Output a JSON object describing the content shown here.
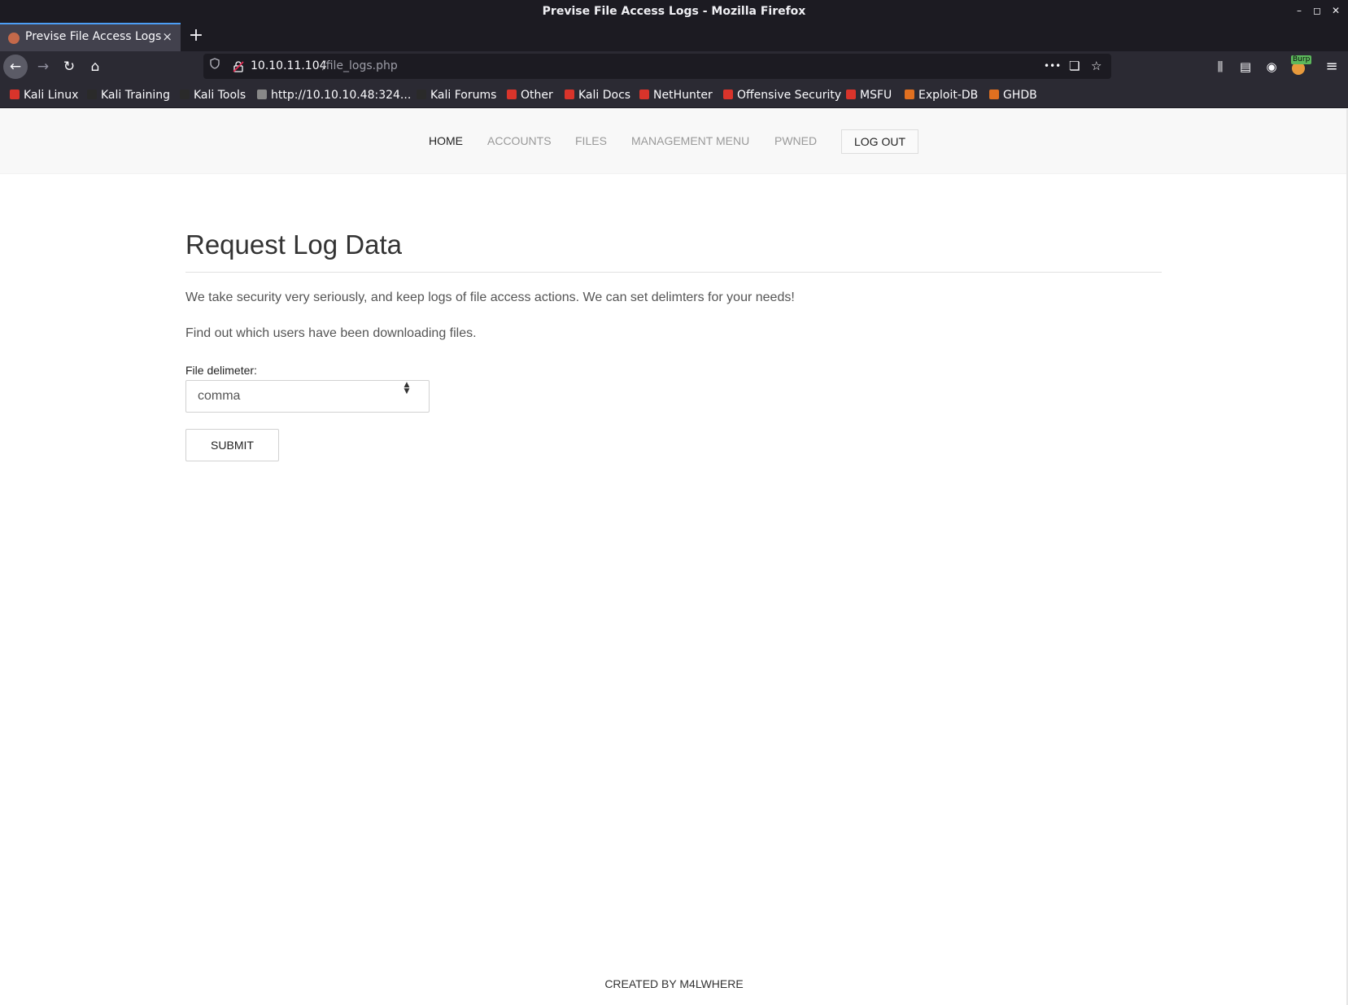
{
  "window": {
    "title": "Previse File Access Logs - Mozilla Firefox",
    "controls": {
      "minimize": "–",
      "maximize": "◻",
      "close": "✕"
    }
  },
  "tabs": [
    {
      "title": "Previse File Access Logs",
      "close": "×",
      "active": true
    }
  ],
  "new_tab_label": "+",
  "navbar": {
    "back_icon": "←",
    "forward_icon": "→",
    "reload_icon": "↻",
    "home_icon": "⌂",
    "url_host": "10.10.11.104",
    "url_path": "/file_logs.php",
    "page_actions_icon": "•••",
    "pocket_icon": "❏",
    "bookmark_star_icon": "☆",
    "library_icon": "⫼",
    "sidebar_icon": "▤",
    "account_icon": "◉",
    "burp_badge": "Burp",
    "menu_icon": "≡"
  },
  "bookmarks": [
    {
      "label": "Kali Linux",
      "color": "#d9342b"
    },
    {
      "label": "Kali Training",
      "color": "#2a2a2a"
    },
    {
      "label": "Kali Tools",
      "color": "#2a2a2a"
    },
    {
      "label": "http://10.10.10.48:324...",
      "color": "#888888"
    },
    {
      "label": "Kali Forums",
      "color": "#2a2a2a"
    },
    {
      "label": "Other",
      "color": "#d9342b"
    },
    {
      "label": "Kali Docs",
      "color": "#d9342b"
    },
    {
      "label": "NetHunter",
      "color": "#d9342b"
    },
    {
      "label": "Offensive Security",
      "color": "#d9342b"
    },
    {
      "label": "MSFU",
      "color": "#d9342b"
    },
    {
      "label": "Exploit-DB",
      "color": "#e07020"
    },
    {
      "label": "GHDB",
      "color": "#e07020"
    }
  ],
  "site_nav": {
    "home": "HOME",
    "accounts": "ACCOUNTS",
    "files": "FILES",
    "management": "MANAGEMENT MENU",
    "pwned": "PWNED",
    "logout": "LOG OUT"
  },
  "main": {
    "heading": "Request Log Data",
    "paragraph1": "We take security very seriously, and keep logs of file access actions. We can set delimters for your needs!",
    "paragraph2": "Find out which users have been downloading files.",
    "delimiter_label": "File delimeter:",
    "delimiter_value": "comma",
    "delimiter_arrow": "▲▼",
    "submit_label": "SUBMIT"
  },
  "footer": "CREATED BY M4LWHERE"
}
